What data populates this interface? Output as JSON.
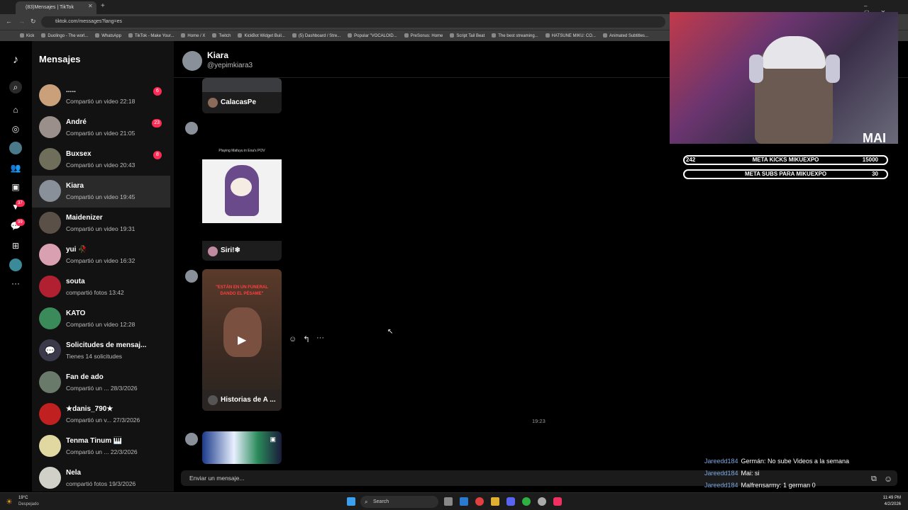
{
  "browser": {
    "tab_title": "(83)Mensajes | TikTok",
    "url": "tiktok.com/messages?lang=es",
    "bookmarks": [
      "Kick",
      "Duolingo - The worl...",
      "WhatsApp",
      "TikTok - Make Your...",
      "Home / X",
      "Twitch",
      "KickBot Widget Buil...",
      "(5) Dashboard / Stre...",
      "Popular \"VOCALOID...",
      "PreSonus: Home",
      "Script Tail Beat",
      "The best streaming...",
      "HATSUNE MIKU: CO...",
      "Animated Subtitles..."
    ]
  },
  "rail": {
    "badge_activity": "37",
    "badge_inbox": "99"
  },
  "sidebar": {
    "title": "Mensajes",
    "conversations": [
      {
        "name": ".....",
        "sub": "Compartió un video 22:18",
        "badge": "6",
        "color": "#c9a07a"
      },
      {
        "name": "André",
        "sub": "Compartió un video 21:05",
        "badge": "23",
        "color": "#9a8f8a"
      },
      {
        "name": "Buxsex",
        "sub": "Compartió un video 20:43",
        "badge": "8",
        "color": "#6e6e5a"
      },
      {
        "name": "Kiara",
        "sub": "Compartió un video 19:45",
        "badge": "",
        "color": "#8a9099"
      },
      {
        "name": "Maidenizer",
        "sub": "Compartió un video 19:31",
        "badge": "",
        "color": "#5a5048"
      },
      {
        "name": "yui 🥀",
        "sub": "Compartió un video 16:32",
        "badge": "",
        "color": "#d8a0b0"
      },
      {
        "name": "souta",
        "sub": "compartió fotos 13:42",
        "badge": "",
        "color": "#b02030"
      },
      {
        "name": "KATO",
        "sub": "Compartió un video 12:28",
        "badge": "",
        "color": "#3a8a5a"
      },
      {
        "name": "Solicitudes de mensaj...",
        "sub": "Tienes 14 solicitudes",
        "badge": "",
        "color": "#3a3a4a"
      },
      {
        "name": "Fan de ado",
        "sub": "Compartió un ...  28/3/2026",
        "badge": "",
        "color": "#6a7a6a"
      },
      {
        "name": "★danis_790★",
        "sub": "Compartió un v...  27/3/2026",
        "badge": "",
        "color": "#c02020"
      },
      {
        "name": "Tenma Tinum 🎹",
        "sub": "Compartió un ...  22/3/2026",
        "badge": "",
        "color": "#e0d8a0"
      },
      {
        "name": "Nela",
        "sub": "compartió fotos 19/3/2026",
        "badge": "",
        "color": "#d0d0c8"
      }
    ]
  },
  "chat": {
    "name": "Kiara",
    "handle": "@yepimkiara3",
    "cards": [
      {
        "author": "CalacasPe"
      },
      {
        "caption": "Playing Mafuyu in Ena's POV",
        "author": "Siri!❄"
      },
      {
        "caption": "\"ESTÁN EN UN FUNERAL DANDO EL PÉSAME\"",
        "author": "Historias de A ..."
      }
    ],
    "timestamp": "19:23",
    "composer_placeholder": "Enviar un mensaje..."
  },
  "overlay": {
    "streamer_logo": "MAI",
    "kicks": {
      "current": "242",
      "label": "META KICKS MIKUEXPO",
      "goal": "15000"
    },
    "subs": {
      "label": "META SUBS PARA MIKUEXPO",
      "goal": "30"
    },
    "stream_chat": [
      {
        "user": "Jareedd184",
        "text": "Germán: No sube Videos a la semana"
      },
      {
        "user": "Jareedd184",
        "text": "Mai: si"
      },
      {
        "user": "Jareedd184",
        "text": "Malfrensarmy: 1 german 0"
      }
    ]
  },
  "taskbar": {
    "weather_temp": "19°C",
    "weather_desc": "Despejado",
    "search": "Search",
    "time": "11:49 PM",
    "date": "4/2/2026"
  }
}
